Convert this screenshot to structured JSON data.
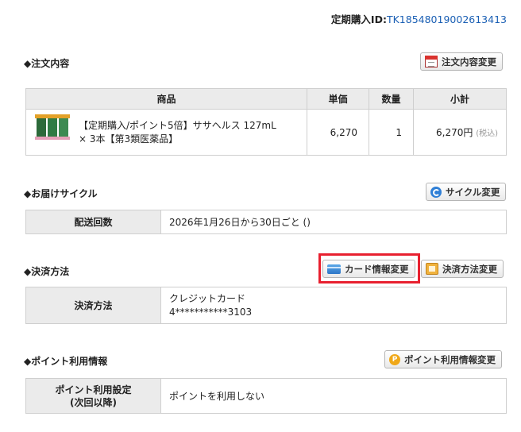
{
  "order_id": {
    "label": "定期購入ID:",
    "value": "TK18548019002613413"
  },
  "order_contents": {
    "title": "◆注文内容",
    "change_button": "注文内容変更",
    "headers": [
      "商品",
      "単価",
      "数量",
      "小計"
    ],
    "item": {
      "name_line1": "【定期購入/ポイント5倍】ササヘルス 127mL",
      "name_line2": "× 3本【第3類医薬品】",
      "unit_price": "6,270",
      "quantity": "1",
      "subtotal": "6,270円",
      "tax_note": "(税込)"
    }
  },
  "delivery_cycle": {
    "title": "◆お届けサイクル",
    "change_button": "サイクル変更",
    "label": "配送回数",
    "value": "2026年1月26日から30日ごと ()"
  },
  "payment": {
    "title": "◆決済方法",
    "card_button": "カード情報変更",
    "method_button": "決済方法変更",
    "label": "決済方法",
    "value_line1": "クレジットカード",
    "value_line2": "4***********3103"
  },
  "points": {
    "title": "◆ポイント利用情報",
    "change_button": "ポイント利用情報変更",
    "label_line1": "ポイント利用設定",
    "label_line2": "(次回以降)",
    "value": "ポイントを利用しない"
  },
  "icons": {
    "order_change": "calendar-icon",
    "cycle_change": "cycle-icon",
    "card_change": "credit-card-icon",
    "method_change": "payment-method-icon",
    "points_change": "point-coin-icon"
  },
  "colors": {
    "accent_link": "#1a5fb4",
    "highlight": "#e8202f"
  }
}
